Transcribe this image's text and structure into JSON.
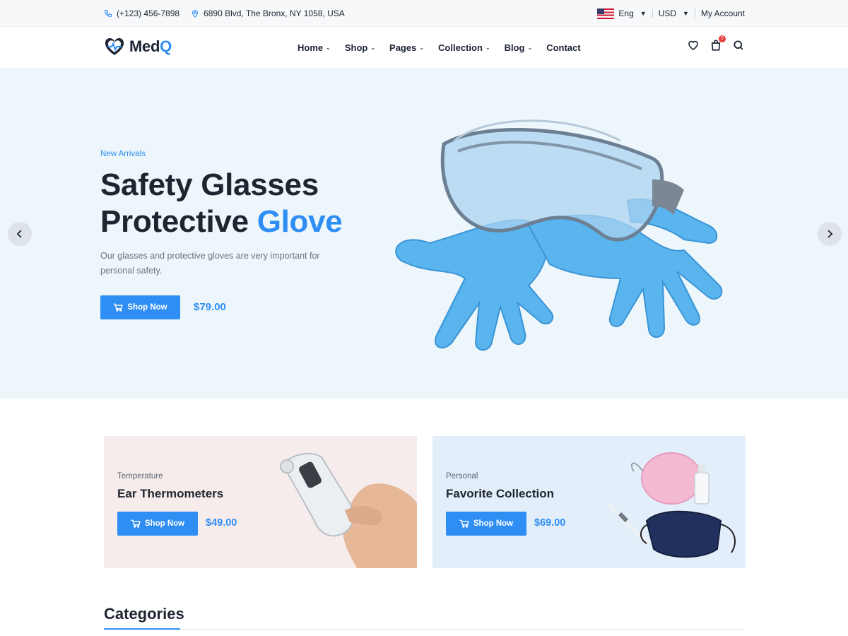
{
  "topbar": {
    "phone": "(+123) 456-7898",
    "address": "6890 Blvd, The Bronx, NY 1058, USA",
    "language": "Eng",
    "currency": "USD",
    "account": "My Account"
  },
  "header": {
    "logo_main": "Med",
    "logo_accent": "Q",
    "nav": [
      {
        "label": "Home",
        "dropdown": true
      },
      {
        "label": "Shop",
        "dropdown": true
      },
      {
        "label": "Pages",
        "dropdown": true
      },
      {
        "label": "Collection",
        "dropdown": true
      },
      {
        "label": "Blog",
        "dropdown": true
      },
      {
        "label": "Contact",
        "dropdown": false
      }
    ],
    "cart_count": "0"
  },
  "hero": {
    "eyebrow": "New Arrivals",
    "title_line1": "Safety Glasses",
    "title_line2_plain": "Protective",
    "title_line2_accent": "Glove",
    "description": "Our glasses and protective gloves are very important for personal safety.",
    "button_label": "Shop Now",
    "price": "$79.00"
  },
  "promos": [
    {
      "category": "Temperature",
      "title": "Ear Thermometers",
      "button_label": "Shop Now",
      "price": "$49.00"
    },
    {
      "category": "Personal",
      "title": "Favorite Collection",
      "button_label": "Shop Now",
      "price": "$69.00"
    }
  ],
  "categories": {
    "title": "Categories"
  },
  "colors": {
    "accent": "#2f8ef4",
    "hero_bg": "#edf6fa",
    "promo1_bg": "#f7ecec",
    "promo2_bg": "#e3eefb"
  }
}
